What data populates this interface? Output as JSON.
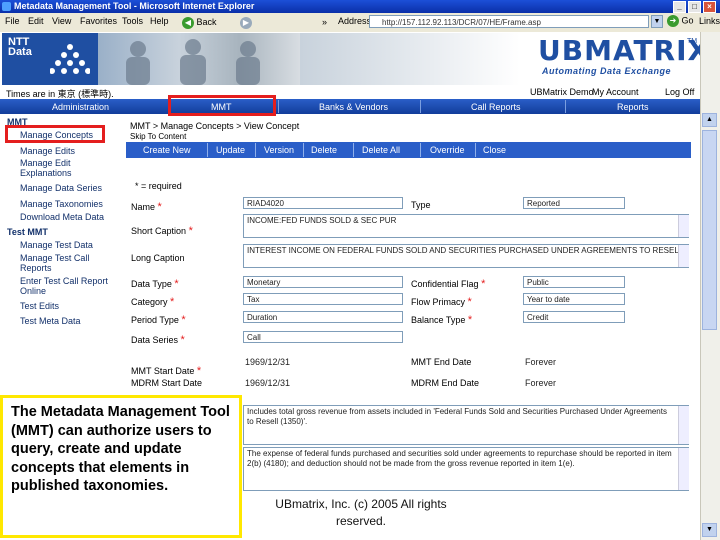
{
  "window": {
    "title": "Metadata Management Tool - Microsoft Internet Explorer"
  },
  "ie_menu": [
    "File",
    "Edit",
    "View",
    "Favorites",
    "Tools",
    "Help"
  ],
  "ie_toolbar": {
    "back_label": "Back",
    "address_label": "Address",
    "address_value": "http://157.112.92.113/DCR/07/HE/Frame.asp",
    "go_label": "Go",
    "links_label": "Links"
  },
  "header": {
    "ntt_logo": "NTT Data",
    "ub_logo": "UBMATRIX",
    "ub_tagline": "Automating Data Exchange",
    "tm": "TM",
    "timezone_label": "Times are in 東京 (標準時).",
    "user": "UBMatrix Demo",
    "my_account": "My Account",
    "logoff": "Log Off"
  },
  "nav": {
    "tabs": [
      "Administration",
      "MMT",
      "Banks & Vendors",
      "Call Reports",
      "Reports"
    ]
  },
  "sidebar": {
    "section_mmt": "MMT",
    "items": [
      "Manage Concepts",
      "Manage Edits",
      "Manage Edit Explanations",
      "Manage Data Series",
      "Manage Taxonomies",
      "Download Meta Data"
    ],
    "section_test": "Test MMT",
    "test_items": [
      "Manage Test Data",
      "Manage Test Call Reports",
      "Enter Test Call Report Online",
      "Test Edits",
      "Test Meta Data"
    ]
  },
  "main": {
    "breadcrumb": "MMT > Manage Concepts > View Concept",
    "skip": "Skip To Content",
    "actions": [
      "Create New",
      "Update",
      "Version",
      "Delete",
      "Delete All",
      "Override",
      "Close"
    ],
    "required_note": "* = required",
    "labels": {
      "name": "Name",
      "short_caption": "Short Caption",
      "long_caption": "Long Caption",
      "data_type": "Data Type",
      "category": "Category",
      "period_type": "Period Type",
      "data_series": "Data Series",
      "type": "Type",
      "confidential_flag": "Confidential Flag",
      "flow_primacy": "Flow Primacy",
      "balance_type": "Balance Type",
      "mmt_start_date": "MMT Start Date",
      "mmt_end_date": "MMT End Date",
      "mdrm_start_date": "MDRM Start Date",
      "mdrm_end_date": "MDRM End Date"
    },
    "values": {
      "name": "RIAD4020",
      "type": "Reported",
      "short_caption": "INCOME:FED FUNDS SOLD & SEC PUR",
      "long_caption": "INTEREST INCOME ON FEDERAL FUNDS SOLD AND SECURITIES PURCHASED UNDER AGREEMENTS TO RESELL",
      "data_type": "Monetary",
      "confidential_flag": "Public",
      "category": "Tax",
      "flow_primacy": "Year to date",
      "period_type": "Duration",
      "balance_type": "Credit",
      "data_series": "Call",
      "mmt_start_date": "1969/12/31",
      "mmt_end_date": "Forever",
      "mdrm_start_date": "1969/12/31",
      "mdrm_end_date": "Forever",
      "description_1": "Includes total gross revenue from assets included in 'Federal Funds Sold and Securities Purchased Under Agreements to Resell (1350)'.",
      "description_2": "The expense of federal funds purchased and securities sold under agreements to repurchase should be reported in item 2(b) (4180); and deduction should not be made from the gross revenue reported in item 1(e)."
    }
  },
  "callout": "The Metadata Management Tool (MMT) can authorize users to query, create and update concepts that elements in published taxonomies.",
  "footer": "UBmatrix, Inc. (c) 2005 All rights reserved.",
  "colors": {
    "nav_blue": "#2a5ec8",
    "highlight_red": "#e41e1e",
    "callout_yellow": "#ffe800",
    "brand_blue": "#1f4fa2"
  }
}
